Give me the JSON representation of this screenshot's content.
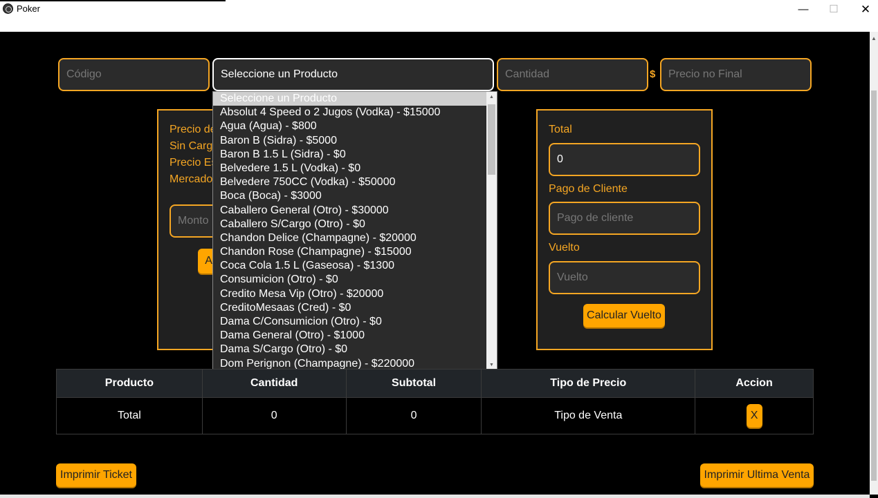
{
  "window": {
    "title": "Poker"
  },
  "inputs": {
    "codigo_placeholder": "Código",
    "producto_selected": "Seleccione un Producto",
    "cantidad_placeholder": "Cantidad",
    "currency_symbol": "$",
    "precio_placeholder": "Precio no Final"
  },
  "left_panel": {
    "labels": [
      "Precio de",
      "Sin Carg",
      "Precio Es",
      "Mercado"
    ],
    "monto_placeholder": "Monto",
    "button_label": "Ag"
  },
  "right_panel": {
    "total_label": "Total",
    "total_value": "0",
    "pago_label": "Pago de Cliente",
    "pago_placeholder": "Pago de cliente",
    "vuelto_label": "Vuelto",
    "vuelto_placeholder": "Vuelto",
    "calcular_button": "Calcular Vuelto"
  },
  "dropdown": {
    "options": [
      "Seleccione un Producto",
      "Absolut 4 Speed o 2 Jugos (Vodka) - $15000",
      "Agua (Agua) - $800",
      "Baron B (Sidra) - $5000",
      "Baron B 1.5 L (Sidra) - $0",
      "Belvedere 1.5 L (Vodka) - $0",
      "Belvedere 750CC (Vodka) - $50000",
      "Boca (Boca) - $3000",
      "Caballero General (Otro) - $30000",
      "Caballero S/Cargo (Otro) - $0",
      "Chandon Delice (Champagne) - $20000",
      "Chandon Rose (Champagne) - $15000",
      "Coca Cola 1.5 L (Gaseosa) - $1300",
      "Consumicion (Otro) - $0",
      "Credito Mesa Vip (Otro) - $20000",
      "CreditoMesaas (Cred) - $0",
      "Dama C/Consumicion (Otro) - $0",
      "Dama General (Otro) - $1000",
      "Dama S/Cargo (Otro) - $0",
      "Dom Perignon (Champagne) - $220000"
    ]
  },
  "table": {
    "headers": [
      "Producto",
      "Cantidad",
      "Subtotal",
      "Tipo de Precio",
      "Accion"
    ],
    "row": {
      "producto": "Total",
      "cantidad": "0",
      "subtotal": "0",
      "tipo": "Tipo de Venta",
      "accion": "X"
    }
  },
  "footer": {
    "imprimir_ticket": "Imprimir Ticket",
    "imprimir_ultima": "Imprimir Ultima Venta"
  },
  "colors": {
    "accent": "#f5a623",
    "button": "#ffa500",
    "background": "#000000",
    "field": "#2b2b2b"
  }
}
